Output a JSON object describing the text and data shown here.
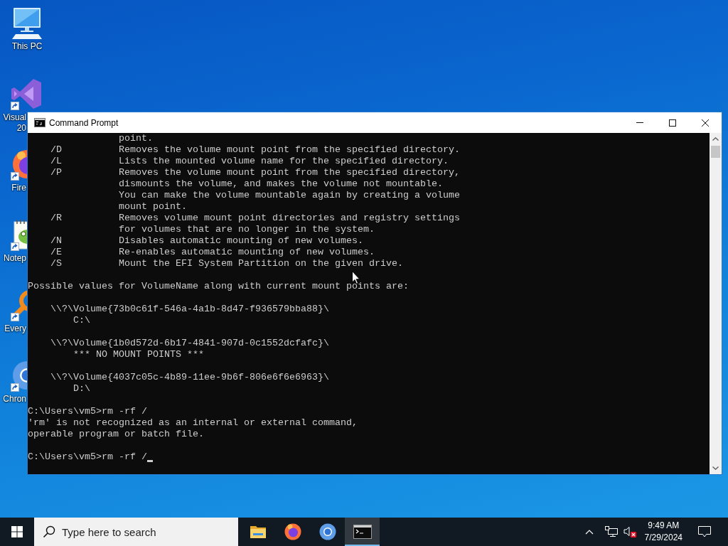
{
  "desktop_icons": [
    {
      "label_lines": [
        "This PC"
      ]
    },
    {
      "label_lines": [
        "Visual",
        "20"
      ]
    },
    {
      "label_lines": [
        "Fire"
      ]
    },
    {
      "label_lines": [
        "Notep"
      ]
    },
    {
      "label_lines": [
        "Every"
      ]
    },
    {
      "label_lines": [
        "Chron"
      ]
    }
  ],
  "window": {
    "title": "Command Prompt"
  },
  "console": {
    "options": [
      {
        "description_lines": [
          "point."
        ]
      },
      {
        "switch": "/D",
        "description_lines": [
          "Removes the volume mount point from the specified directory."
        ]
      },
      {
        "switch": "/L",
        "description_lines": [
          "Lists the mounted volume name for the specified directory."
        ]
      },
      {
        "switch": "/P",
        "description_lines": [
          "Removes the volume mount point from the specified directory,",
          "dismounts the volume, and makes the volume not mountable.",
          "You can make the volume mountable again by creating a volume",
          "mount point."
        ]
      },
      {
        "switch": "/R",
        "description_lines": [
          "Removes volume mount point directories and registry settings",
          "for volumes that are no longer in the system."
        ]
      },
      {
        "switch": "/N",
        "description_lines": [
          "Disables automatic mounting of new volumes."
        ]
      },
      {
        "switch": "/E",
        "description_lines": [
          "Re-enables automatic mounting of new volumes."
        ]
      },
      {
        "switch": "/S",
        "description_lines": [
          "Mount the EFI System Partition on the given drive."
        ]
      }
    ],
    "volumes_heading": "Possible values for VolumeName along with current mount points are:",
    "volumes": [
      {
        "path": "\\\\?\\Volume{73b0c61f-546a-4a1b-8d47-f936579bba88}\\",
        "mount": "C:\\"
      },
      {
        "path": "\\\\?\\Volume{1b0d572d-6b17-4841-907d-0c1552dcfafc}\\",
        "mount": "*** NO MOUNT POINTS ***"
      },
      {
        "path": "\\\\?\\Volume{4037c05c-4b89-11ee-9b6f-806e6f6e6963}\\",
        "mount": "D:\\"
      }
    ],
    "history": [
      {
        "command": "C:\\Users\\vm5>rm -rf /",
        "output": [
          "'rm' is not recognized as an internal or external command,",
          "operable program or batch file."
        ],
        "cursor": false
      },
      {
        "command": "C:\\Users\\vm5>rm -rf /",
        "cursor": true
      }
    ]
  },
  "taskbar": {
    "search": {
      "placeholder": "Type here to search"
    },
    "apps": [
      {
        "active": false
      },
      {
        "active": false
      },
      {
        "active": false
      },
      {
        "active": true
      }
    ],
    "volume_muted": true,
    "clock": {
      "time": "9:49 AM",
      "date": "7/29/2024"
    }
  }
}
